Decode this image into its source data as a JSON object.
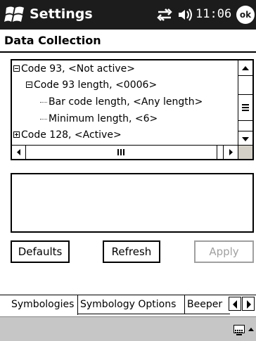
{
  "titlebar": {
    "title": "Settings",
    "time": "11:06",
    "ok_label": "ok",
    "icons": [
      "windows-start-icon",
      "connectivity-icon",
      "volume-icon"
    ]
  },
  "page": {
    "heading": "Data Collection"
  },
  "tree": {
    "items": [
      {
        "label": "Code 93, <Not active>",
        "expander": "minus"
      },
      {
        "label": "Code 93 length, <0006>",
        "expander": "minus"
      },
      {
        "label": "Bar code length, <Any length>",
        "expander": "none"
      },
      {
        "label": "Minimum length, <6>",
        "expander": "none"
      },
      {
        "label": "Code 128, <Active>",
        "expander": "plus"
      }
    ]
  },
  "buttons": {
    "defaults": "Defaults",
    "refresh": "Refresh",
    "apply": "Apply"
  },
  "tabs": [
    {
      "label": "Symbologies",
      "active": true
    },
    {
      "label": "Symbology Options",
      "active": false
    },
    {
      "label": "Beeper",
      "active": false
    }
  ],
  "colors": {
    "titlebar_bg": "#1c1c1c",
    "disabled_text": "#a0a0a0",
    "command_bar_bg": "#c6c6c6"
  }
}
